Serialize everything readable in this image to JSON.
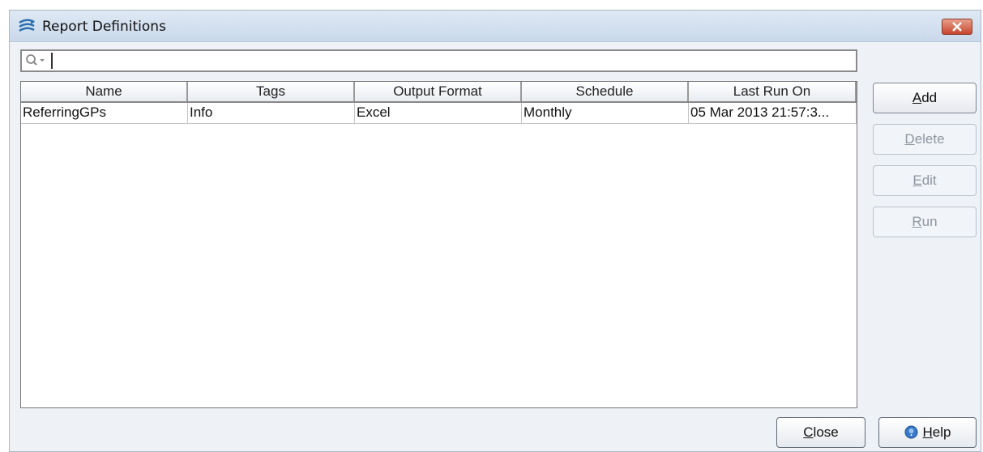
{
  "window": {
    "title": "Report Definitions"
  },
  "search": {
    "value": "",
    "placeholder": ""
  },
  "table": {
    "columns": [
      "Name",
      "Tags",
      "Output Format",
      "Schedule",
      "Last Run On"
    ],
    "rows": [
      [
        "ReferringGPs",
        "Info",
        "Excel",
        "Monthly",
        "05 Mar 2013 21:57:3..."
      ]
    ]
  },
  "buttons": {
    "add": {
      "mnemonic": "A",
      "rest": "dd"
    },
    "delete": {
      "mnemonic": "D",
      "rest": "elete"
    },
    "edit": {
      "mnemonic": "E",
      "rest": "dit"
    },
    "run": {
      "mnemonic": "R",
      "rest": "un"
    },
    "close": {
      "mnemonic": "C",
      "rest": "lose"
    },
    "help": {
      "mnemonic": "H",
      "rest": "elp"
    }
  },
  "colors": {
    "titlebar": "#c9d8ea",
    "window_bg": "#eef2f7",
    "close_button": "#c8452e",
    "disabled_text": "#8d96a0"
  }
}
